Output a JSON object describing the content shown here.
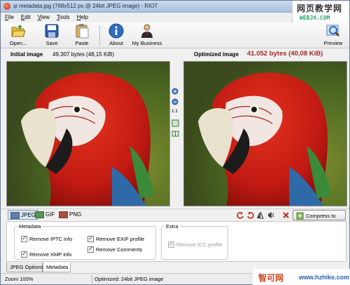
{
  "window": {
    "title": "şi metadata.jpg (768x512 px @ 24bit JPEG image) - RIOT"
  },
  "watermark_top": {
    "cn": "网页教学网",
    "url": "WEBJX.COM"
  },
  "menu": [
    "File",
    "Edit",
    "View",
    "Tools",
    "Help"
  ],
  "toolbar": {
    "open": "Open...",
    "save": "Save",
    "paste": "Paste",
    "about": "About",
    "my_business": "My Business",
    "preview": "Preview"
  },
  "initial": {
    "label": "Initial image",
    "size": "49.307 bytes (48,15 KiB)"
  },
  "optimized": {
    "label": "Optimized image",
    "size": "41.052 bytes (40,08 KiB)"
  },
  "zoom_ratio": "1:1",
  "formats": [
    "JPEG",
    "GIF",
    "PNG"
  ],
  "compress_button": "Compress to size",
  "metadata": {
    "legend": "Metadata",
    "remove_iptc": "Remove IPTC info",
    "remove_exif": "Remove EXIF profile",
    "remove_xmp": "Remove XMP info",
    "remove_comments": "Remove Comments"
  },
  "extra": {
    "legend": "Extra",
    "remove_icc": "Remove ICC profile"
  },
  "tabs": [
    "JPEG Options",
    "Metadata"
  ],
  "status": {
    "zoom": "Zoom 100%",
    "info": "Optimized: 24bit JPEG image"
  },
  "watermark_bottom": {
    "cn": "智可网",
    "url": "www.hzhike.com"
  },
  "colors": {
    "optimized_size": "#a0282a",
    "titlebar": "#b8cfe7"
  }
}
